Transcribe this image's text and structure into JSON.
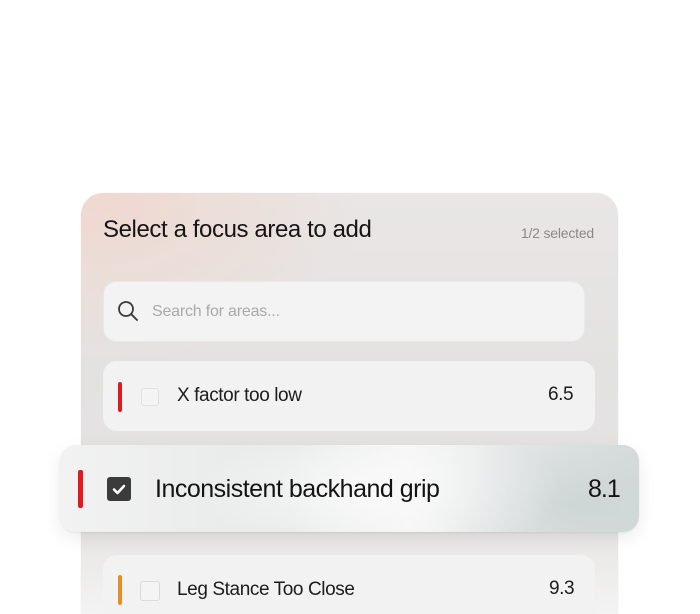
{
  "dialog": {
    "title": "Select a focus area to add",
    "selection_count": "1/2 selected"
  },
  "search": {
    "placeholder": "Search for areas...",
    "value": ""
  },
  "items": [
    {
      "label": "X factor too low",
      "score": "6.5",
      "checked": false,
      "accent_color": "#e3191d"
    },
    {
      "label": "Inconsistent backhand grip",
      "score": "8.1",
      "checked": true,
      "accent_color": "#e3191d"
    },
    {
      "label": "Leg Stance Too Close",
      "score": "9.3",
      "checked": false,
      "accent_color": "#e58e26"
    }
  ],
  "icons": {
    "search": "search-icon",
    "check": "check-icon"
  }
}
